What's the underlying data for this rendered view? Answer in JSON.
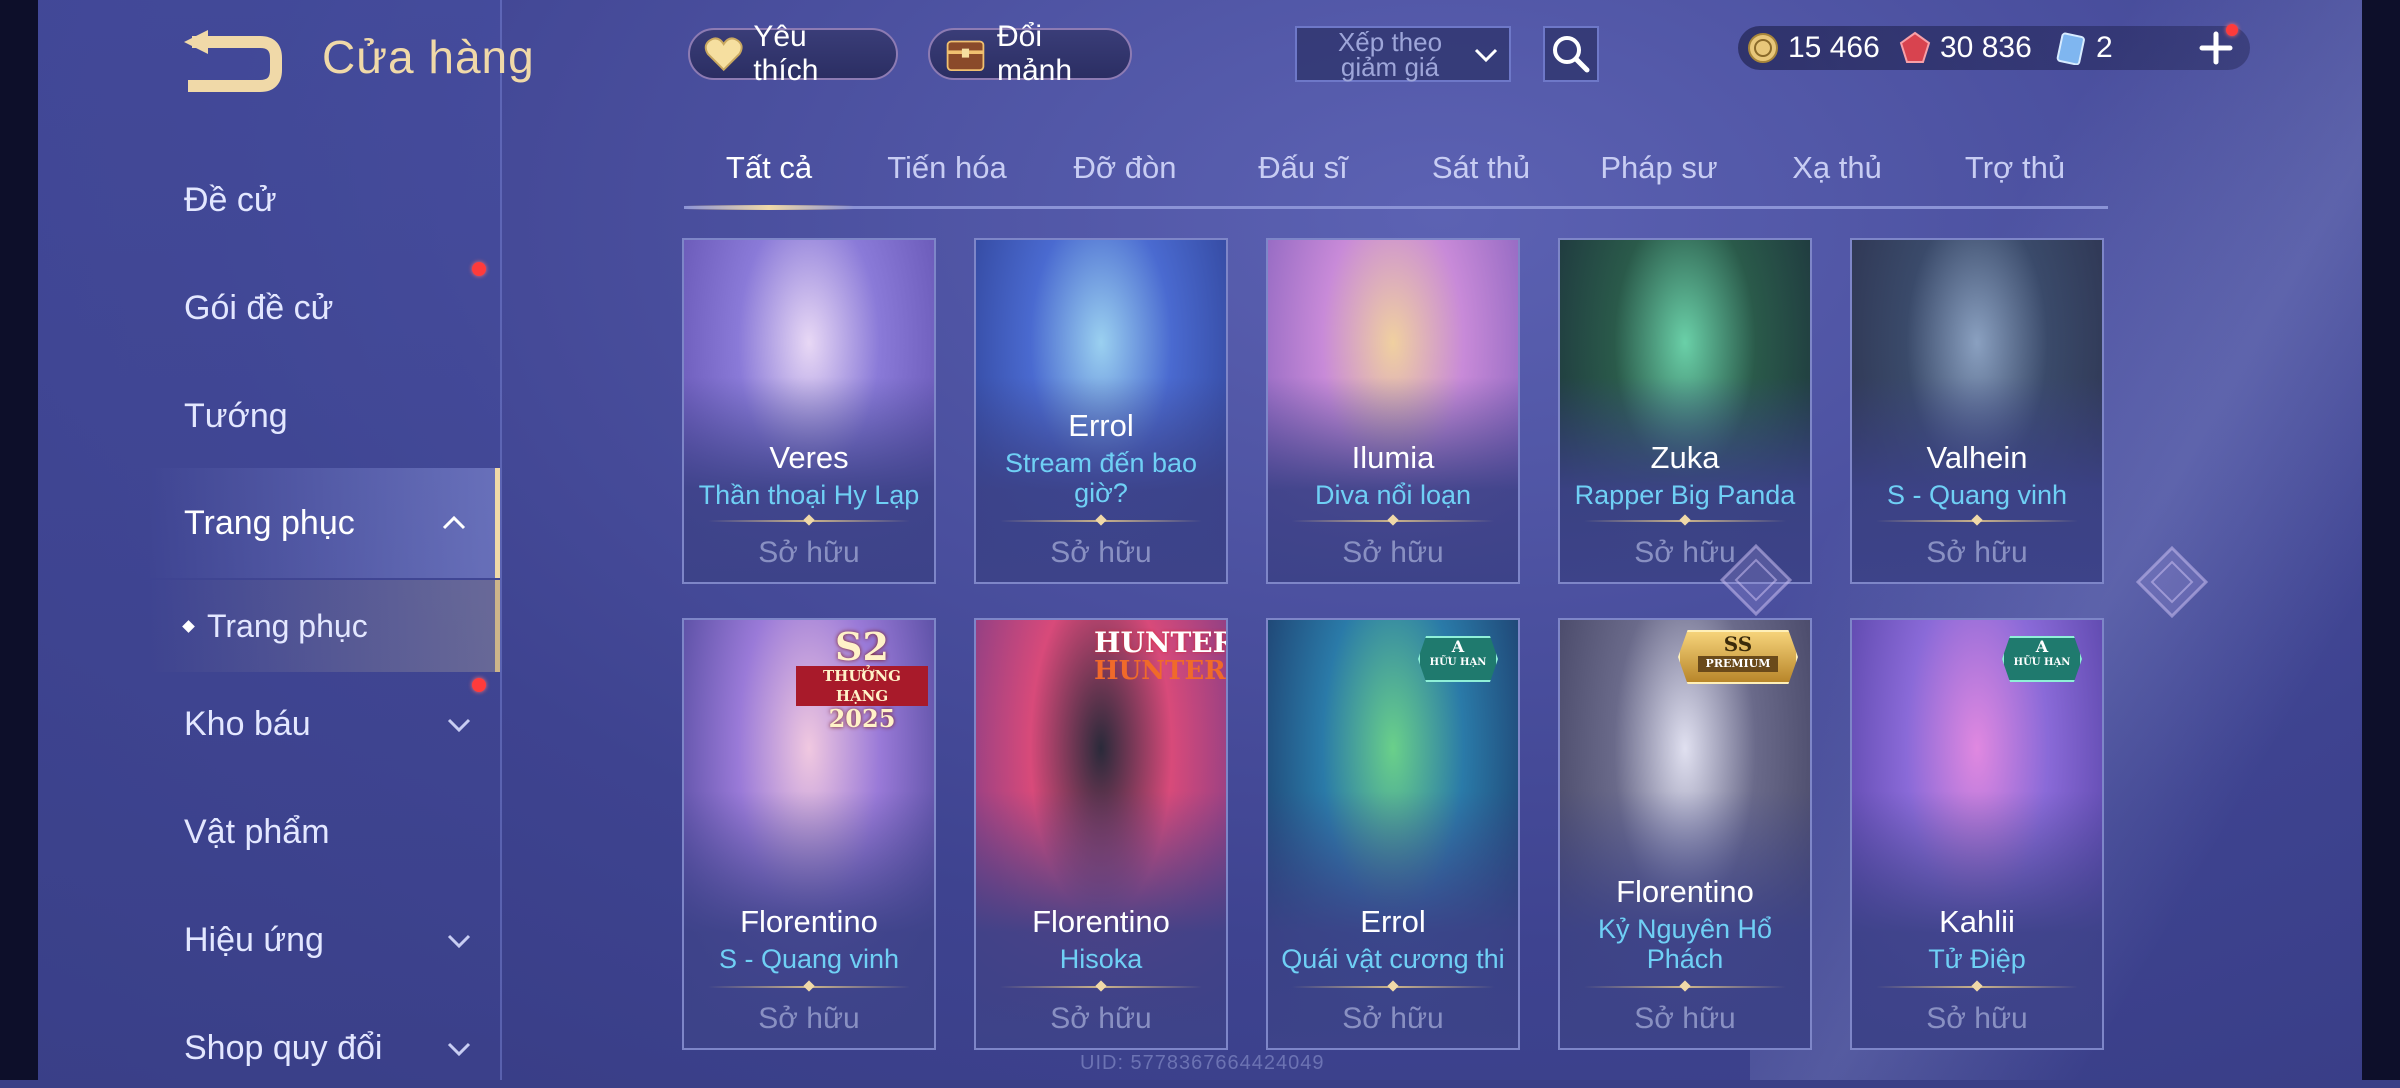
{
  "header": {
    "title": "Cửa hàng",
    "favorite_label": "Yêu thích",
    "exchange_label": "Đổi mảnh",
    "sort_label": "Xếp theo giảm giá"
  },
  "currency": {
    "gold": "15 466",
    "vouchers": "30 836",
    "tickets": "2"
  },
  "sidebar": {
    "items": [
      {
        "label": "Đề cử"
      },
      {
        "label": "Gói đề cử"
      },
      {
        "label": "Tướng"
      },
      {
        "label": "Trang phục"
      },
      {
        "label": "Trang phục"
      },
      {
        "label": "Kho báu"
      },
      {
        "label": "Vật phẩm"
      },
      {
        "label": "Hiệu ứng"
      },
      {
        "label": "Shop quy đổi"
      }
    ]
  },
  "tabs": [
    {
      "label": "Tất cả"
    },
    {
      "label": "Tiến hóa"
    },
    {
      "label": "Đỡ đòn"
    },
    {
      "label": "Đấu sĩ"
    },
    {
      "label": "Sát thủ"
    },
    {
      "label": "Pháp sư"
    },
    {
      "label": "Xạ thủ"
    },
    {
      "label": "Trợ thủ"
    }
  ],
  "cards": [
    {
      "hero": "Veres",
      "skin": "Thần thoại Hy Lạp",
      "status": "Sở hữu",
      "colors": [
        "#8a7ad8",
        "#e8d8f5",
        "#5a4aa8"
      ]
    },
    {
      "hero": "Errol",
      "skin": "Stream đến bao giờ?",
      "status": "Sở hữu",
      "colors": [
        "#4a6ad0",
        "#9ad0f0",
        "#2a3a8a"
      ]
    },
    {
      "hero": "Ilumia",
      "skin": "Diva nổi loạn",
      "status": "Sở hữu",
      "colors": [
        "#c88ad8",
        "#f0d0a0",
        "#7a5ab8"
      ]
    },
    {
      "hero": "Zuka",
      "skin": "Rapper Big Panda",
      "status": "Sở hữu",
      "colors": [
        "#2a5a4a",
        "#6ad0a8",
        "#1a2a3a"
      ]
    },
    {
      "hero": "Valhein",
      "skin": "S - Quang vinh",
      "status": "Sở hữu",
      "colors": [
        "#3a4a6a",
        "#8aa0c0",
        "#2a2e4a"
      ]
    },
    {
      "hero": "Florentino",
      "skin": "S - Quang vinh",
      "status": "Sở hữu",
      "colors": [
        "#9a7ad8",
        "#f0c8e0",
        "#3a3a8a"
      ],
      "badge": {
        "top": "S2",
        "mid": "THƯỞNG HẠNG",
        "bot": "2025"
      }
    },
    {
      "hero": "Florentino",
      "skin": "Hisoka",
      "status": "Sở hữu",
      "colors": [
        "#d84a7a",
        "#2a2a3a",
        "#6a3a8a"
      ],
      "badge": {
        "top": "HUNTER",
        "mid": "",
        "bot": "HUNTER"
      }
    },
    {
      "hero": "Errol",
      "skin": "Quái vật cương thi",
      "status": "Sở hữu",
      "colors": [
        "#2a7aa8",
        "#6ad08a",
        "#1a2a5a"
      ],
      "badge": {
        "top": "A",
        "mid": "HỮU HẠN",
        "bot": ""
      }
    },
    {
      "hero": "Florentino",
      "skin": "Kỷ Nguyên Hổ Phách",
      "status": "Sở hữu",
      "colors": [
        "#6a6a8a",
        "#e0e0f0",
        "#3a3a5a"
      ],
      "badge": {
        "top": "SS",
        "mid": "PREMIUM",
        "bot": ""
      }
    },
    {
      "hero": "Kahlii",
      "skin": "Tử Điệp",
      "status": "Sở hữu",
      "colors": [
        "#8a6ad8",
        "#e088e0",
        "#4a3a9a"
      ],
      "badge": {
        "top": "A",
        "mid": "HỮU HẠN",
        "bot": ""
      }
    }
  ],
  "footer": {
    "uid": "UID: 5778367664424049"
  }
}
